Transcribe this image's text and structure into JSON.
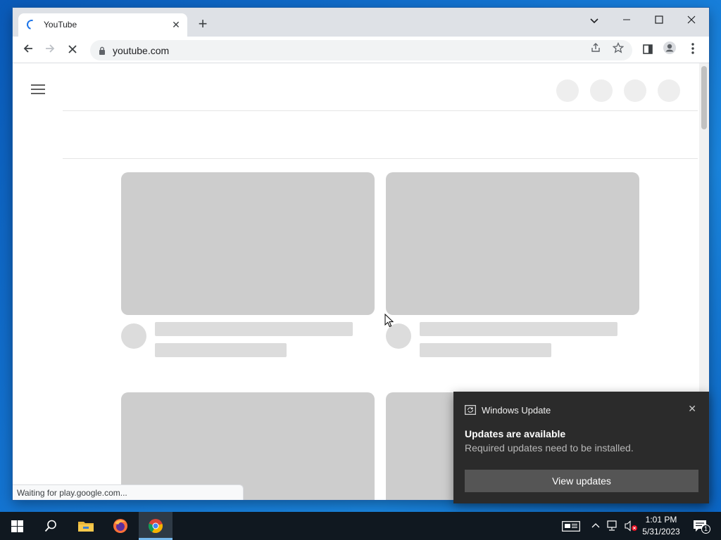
{
  "browser": {
    "tab_title": "YouTube",
    "url": "youtube.com",
    "status_text": "Waiting for play.google.com..."
  },
  "notification": {
    "app_name": "Windows Update",
    "title": "Updates are available",
    "body": "Required updates need to be installed.",
    "button_label": "View updates"
  },
  "clock": {
    "time": "1:01 PM",
    "date": "5/31/2023"
  },
  "tray": {
    "notification_count": "1"
  },
  "colors": {
    "accent": "#1a73e8",
    "skeleton": "#cdcdcd",
    "toast_bg": "#2b2b2b",
    "taskbar_bg": "#101820"
  }
}
